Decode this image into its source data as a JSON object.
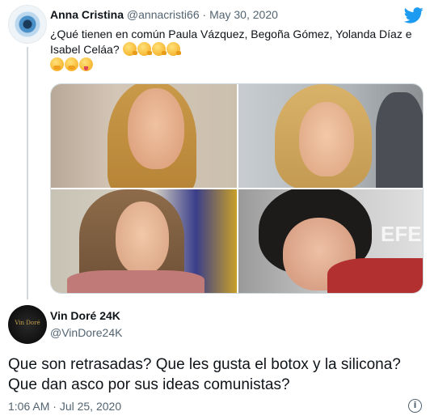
{
  "quoted_tweet": {
    "author_name": "Anna Cristina",
    "author_handle": "@annacristi66",
    "separator": "·",
    "date": "May 30, 2020",
    "text": "¿Qué tienen en común Paula Vázquez, Begoña Gómez, Yolanda Díaz e Isabel Celáa?",
    "emojis_line1": [
      "thinking-face",
      "thinking-face",
      "thinking-face",
      "thinking-face"
    ],
    "emojis_line2": [
      "face-with-hand-over-mouth",
      "face-with-hand-over-mouth",
      "squinting-face-with-tongue"
    ],
    "photos": [
      "photo-1",
      "photo-2",
      "photo-3",
      "photo-4"
    ],
    "photo4_watermark": "EFE"
  },
  "reply_tweet": {
    "author_name": "Vin Doré 24K",
    "author_handle": "@VinDore24K",
    "avatar_text": "Vin Doré",
    "body": "Que son retrasadas? Que les gusta el botox y la silicona? Que dan asco por sus ideas comunistas?",
    "time": "1:06 AM",
    "separator": "·",
    "date": "Jul 25, 2020"
  },
  "icons": {
    "brand": "twitter-bird-icon",
    "info": "info-icon"
  },
  "colors": {
    "brand_blue": "#1d9bf0",
    "text_primary": "#0f1419",
    "text_secondary": "#536471",
    "thread_line": "#cfd9de"
  }
}
